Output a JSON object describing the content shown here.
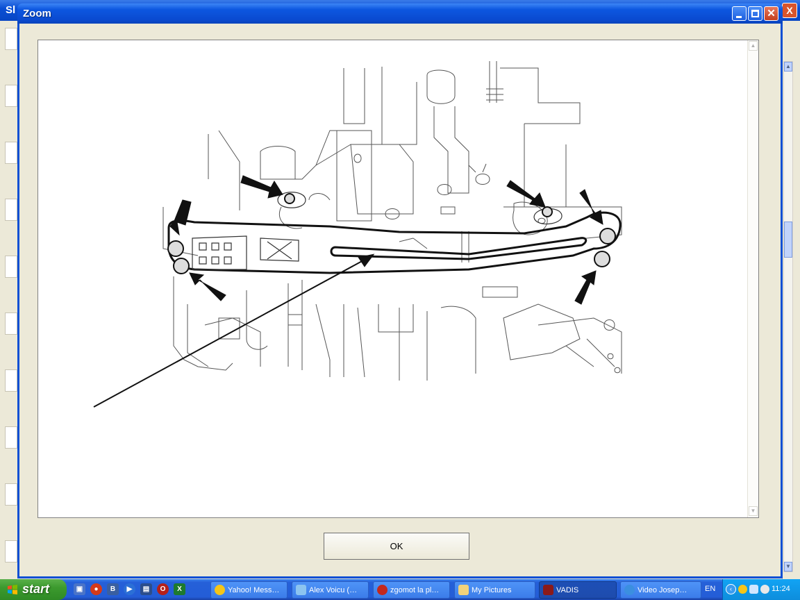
{
  "background_window": {
    "title_fragment": "Sl",
    "close_label": "X"
  },
  "dialog": {
    "title": "Zoom",
    "ok_label": "OK"
  },
  "taskbar": {
    "start_label": "start",
    "quicklaunch_more": "»",
    "tasks": [
      {
        "label": "Yahoo! Mess…",
        "icon": "yahoo-messenger-icon",
        "active": false
      },
      {
        "label": "Alex Voicu (…",
        "icon": "chat-icon",
        "active": false
      },
      {
        "label": "zgomot la pl…",
        "icon": "opera-icon",
        "active": false
      },
      {
        "label": "My Pictures",
        "icon": "folder-icon",
        "active": false
      },
      {
        "label": "VADIS",
        "icon": "vadis-app-icon",
        "active": true
      },
      {
        "label": "Video Josep…",
        "icon": "internet-explorer-icon",
        "active": false
      }
    ],
    "language": "EN",
    "clock": "11:24"
  },
  "colors": {
    "titlebar_blue": "#0a4fd4",
    "taskbar_blue": "#245dd7",
    "start_green": "#3c9a2e",
    "tray_blue": "#0d8ddc"
  }
}
